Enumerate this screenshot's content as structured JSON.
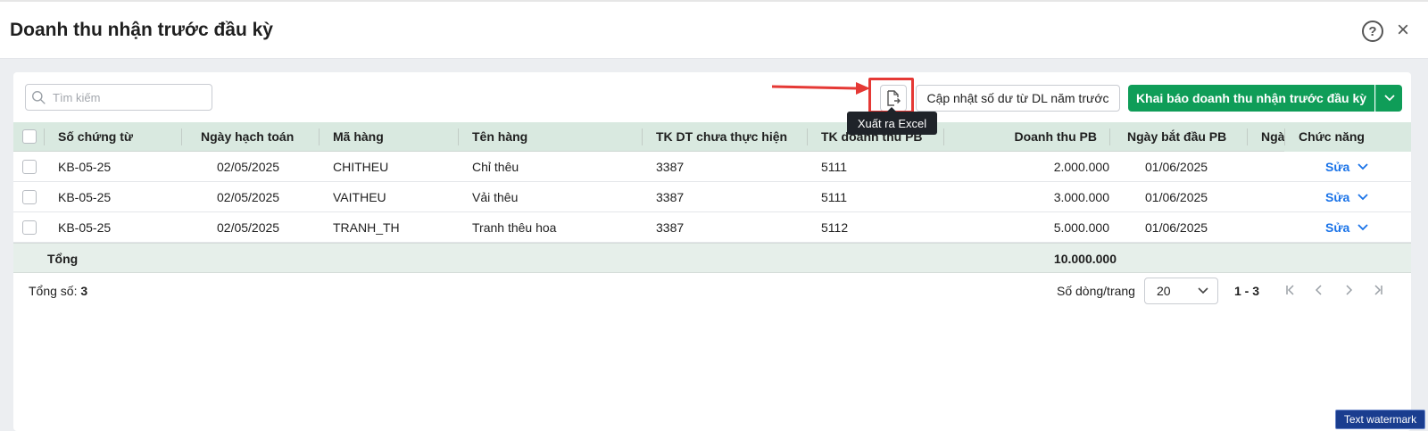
{
  "dialog": {
    "title": "Doanh thu nhận trước đầu kỳ",
    "help_label": "?",
    "close_label": "×"
  },
  "toolbar": {
    "search_placeholder": "Tìm kiếm",
    "export_tooltip": "Xuất ra Excel",
    "update_label": "Cập nhật số dư từ DL năm trước",
    "declare_label": "Khai báo doanh thu nhận trước đầu kỳ"
  },
  "table": {
    "columns": [
      "Số chứng từ",
      "Ngày hạch toán",
      "Mã hàng",
      "Tên hàng",
      "TK DT chưa thực hiện",
      "TK doanh thu PB",
      "Doanh thu PB",
      "Ngày bắt đầu PB",
      "Ngà",
      "Chức năng"
    ],
    "rows": [
      {
        "voucher": "KB-05-25",
        "date": "02/05/2025",
        "code": "CHITHEU",
        "name": "Chỉ thêu",
        "unearned_account": "3387",
        "revenue_account": "5111",
        "amount": "2.000.000",
        "start_date": "01/06/2025",
        "action": "Sửa"
      },
      {
        "voucher": "KB-05-25",
        "date": "02/05/2025",
        "code": "VAITHEU",
        "name": "Vải thêu",
        "unearned_account": "3387",
        "revenue_account": "5111",
        "amount": "3.000.000",
        "start_date": "01/06/2025",
        "action": "Sửa"
      },
      {
        "voucher": "KB-05-25",
        "date": "02/05/2025",
        "code": "TRANH_TH",
        "name": "Tranh thêu hoa",
        "unearned_account": "3387",
        "revenue_account": "5112",
        "amount": "5.000.000",
        "start_date": "01/06/2025",
        "action": "Sửa"
      }
    ],
    "total_label": "Tổng",
    "total_amount": "10.000.000"
  },
  "footer": {
    "total_count_label": "Tổng số:",
    "total_count": "3",
    "rows_per_page_label": "Số dòng/trang",
    "rows_per_page": "20",
    "range": "1 - 3"
  },
  "watermark": "Text watermark",
  "colors": {
    "primary_green": "#0f9d58",
    "header_green": "#d9e9e0",
    "link_blue": "#1a73e8",
    "annotation_red": "#e53935"
  }
}
